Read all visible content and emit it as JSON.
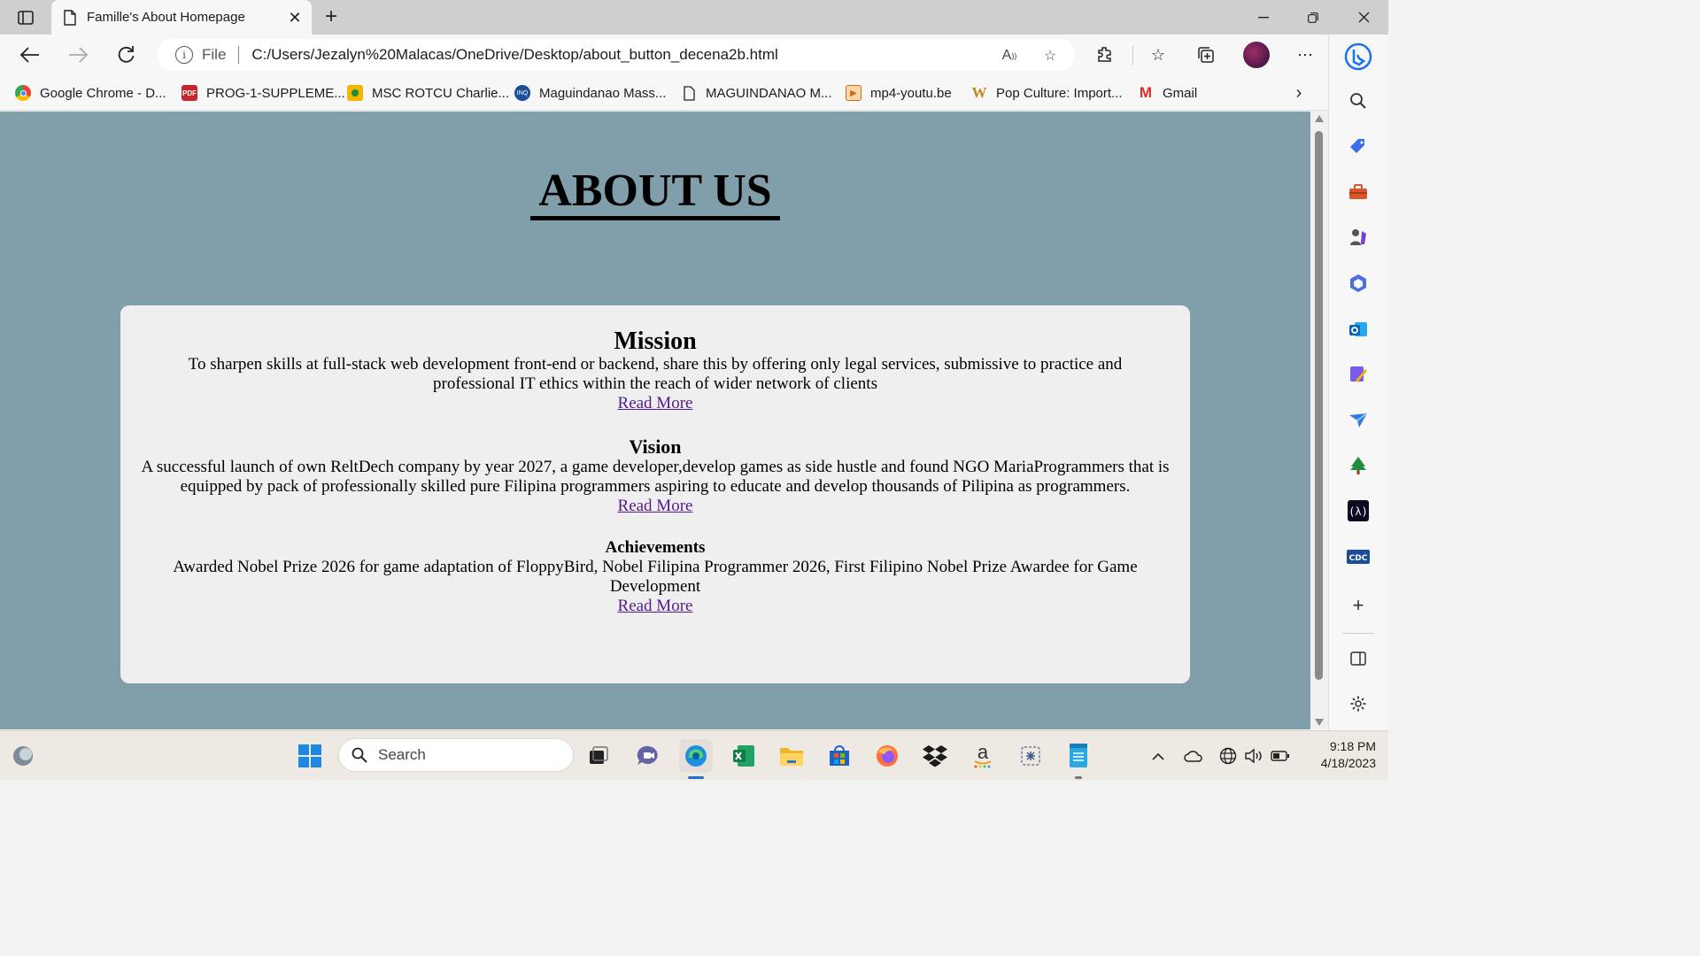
{
  "browser": {
    "tab_title": "Famille's About Homepage",
    "address": {
      "scheme_label": "File",
      "url": "C:/Users/Jezalyn%20Malacas/OneDrive/Desktop/about_button_decena2b.html"
    },
    "favorites": [
      {
        "label": "Google Chrome - D...",
        "icon": "chrome-icon"
      },
      {
        "label": "PROG-1-SUPPLEME...",
        "icon": "pdf-icon"
      },
      {
        "label": "MSC ROTCU Charlie...",
        "icon": "classroom-icon"
      },
      {
        "label": "Maguindanao Mass...",
        "icon": "inquirer-icon"
      },
      {
        "label": "MAGUINDANAO M...",
        "icon": "document-icon"
      },
      {
        "label": "mp4-youtu.be",
        "icon": "video-icon"
      },
      {
        "label": "Pop Culture: Import...",
        "icon": "wikipedia-icon"
      },
      {
        "label": "Gmail",
        "icon": "gmail-icon"
      }
    ]
  },
  "page": {
    "title": "ABOUT US",
    "background_color": "#809fab",
    "sections": [
      {
        "heading": "Mission",
        "text": "To sharpen skills at full-stack web development front-end or backend, share this by offering only legal services, submissive to practice and professional IT ethics within the reach of wider network of clients",
        "link": "Read More"
      },
      {
        "heading": "Vision",
        "text": "A successful launch of own ReltDech company by year 2027, a game developer,develop games as side hustle and found NGO MariaProgrammers that is equipped by pack of professionally skilled pure Filipina programmers aspiring to educate and develop thousands of Pilipina as programmers.",
        "link": "Read More"
      },
      {
        "heading": "Achievements",
        "text": "Awarded Nobel Prize 2026 for game adaptation of FloppyBird, Nobel Filipina Programmer 2026, First Filipino Nobel Prize Awardee for Game Development",
        "link": "Read More"
      }
    ]
  },
  "taskbar": {
    "search_placeholder": "Search",
    "time": "9:18 PM",
    "date": "4/18/2023"
  }
}
